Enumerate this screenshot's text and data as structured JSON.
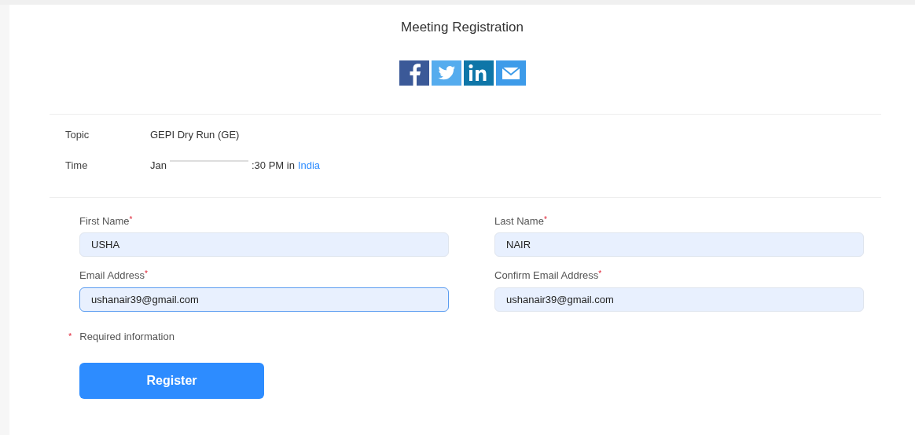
{
  "page_title": "Meeting Registration",
  "share_icons": [
    {
      "kind": "facebook"
    },
    {
      "kind": "twitter"
    },
    {
      "kind": "linkedin"
    },
    {
      "kind": "email"
    }
  ],
  "details": [
    {
      "label": "Topic",
      "parts": [
        {
          "kind": "text",
          "text": "GEPI Dry Run (GE)"
        }
      ]
    },
    {
      "label": "Time",
      "parts": [
        {
          "kind": "text",
          "text": "Jan"
        },
        {
          "kind": "redacted"
        },
        {
          "kind": "text",
          "text": ":30 PM in"
        },
        {
          "kind": "link",
          "text": "India"
        }
      ]
    }
  ],
  "fields": [
    {
      "label": "First Name",
      "required_mark": "*",
      "value": "USHA",
      "focused": false
    },
    {
      "label": "Last Name",
      "required_mark": "*",
      "value": "NAIR",
      "focused": false
    },
    {
      "label": "Email Address",
      "required_mark": "*",
      "value": "ushanair39@gmail.com",
      "focused": true
    },
    {
      "label": "Confirm Email Address",
      "required_mark": "*",
      "value": "ushanair39@gmail.com",
      "focused": false
    }
  ],
  "required_note": {
    "mark": "*",
    "text": "Required information"
  },
  "register_button": "Register"
}
